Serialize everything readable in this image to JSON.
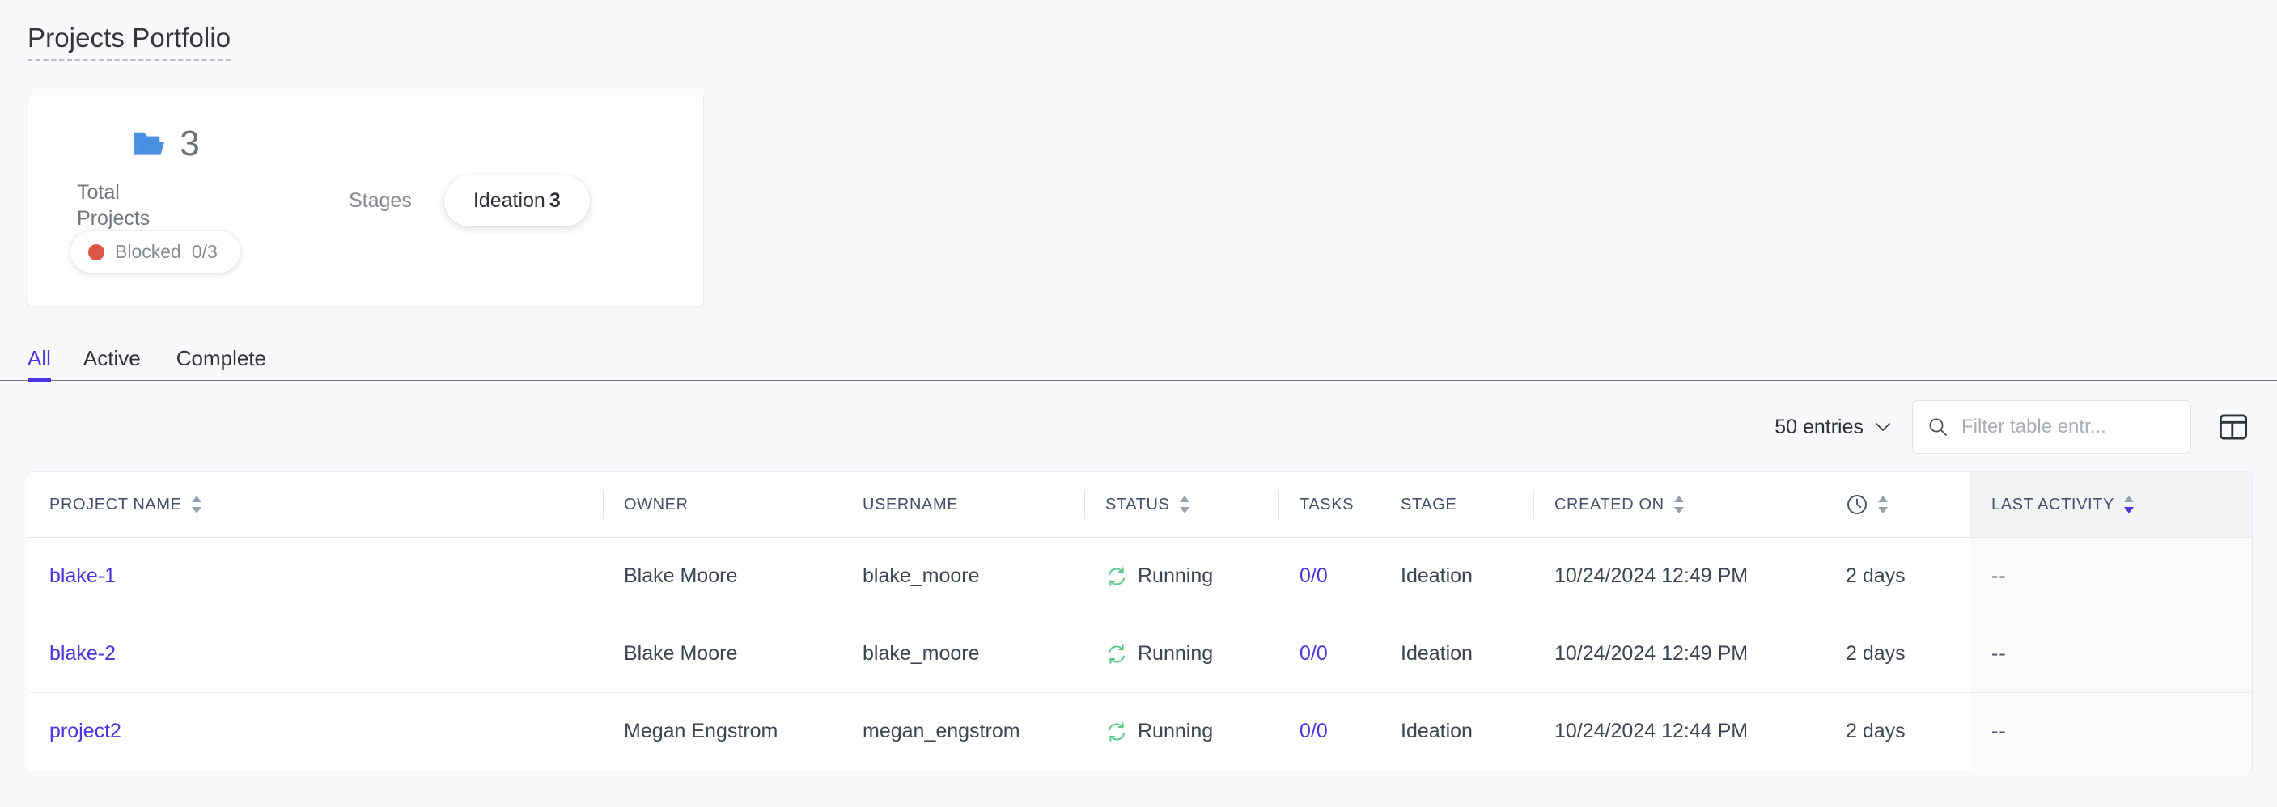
{
  "page": {
    "title": "Projects Portfolio"
  },
  "summary": {
    "total_card": {
      "icon": "folder-icon",
      "count": "3",
      "label": "Total Projects",
      "blocked_badge": {
        "dot_color": "#dc5549",
        "label": "Blocked",
        "value": "0/3"
      }
    },
    "stages_card": {
      "label": "Stages",
      "pills": [
        {
          "name": "Ideation",
          "count": "3"
        }
      ]
    }
  },
  "tabs": [
    {
      "label": "All",
      "active": true
    },
    {
      "label": "Active",
      "active": false
    },
    {
      "label": "Complete",
      "active": false
    }
  ],
  "toolbar": {
    "entries_label": "50 entries",
    "search_placeholder": "Filter table entr...",
    "search_value": "",
    "layout_button_title": "Table layout"
  },
  "table": {
    "columns": [
      {
        "key": "project_name",
        "label": "PROJECT NAME",
        "sortable": true,
        "sorted": "none"
      },
      {
        "key": "owner",
        "label": "OWNER",
        "sortable": false,
        "sorted": "none"
      },
      {
        "key": "username",
        "label": "USERNAME",
        "sortable": false,
        "sorted": "none"
      },
      {
        "key": "status",
        "label": "STATUS",
        "sortable": true,
        "sorted": "none"
      },
      {
        "key": "tasks",
        "label": "TASKS",
        "sortable": false,
        "sorted": "none"
      },
      {
        "key": "stage",
        "label": "STAGE",
        "sortable": false,
        "sorted": "none"
      },
      {
        "key": "created_on",
        "label": "CREATED ON",
        "sortable": true,
        "sorted": "none"
      },
      {
        "key": "duration",
        "label": "",
        "sortable": true,
        "sorted": "none",
        "icon": "clock-icon"
      },
      {
        "key": "last_activity",
        "label": "LAST ACTIVITY",
        "sortable": true,
        "sorted": "desc"
      }
    ],
    "rows": [
      {
        "project_name": "blake-1",
        "owner": "Blake Moore",
        "username": "blake_moore",
        "status": "Running",
        "status_icon": "sync-icon",
        "tasks": "0/0",
        "stage": "Ideation",
        "created_on": "10/24/2024 12:49 PM",
        "duration": "2 days",
        "last_activity": "--"
      },
      {
        "project_name": "blake-2",
        "owner": "Blake Moore",
        "username": "blake_moore",
        "status": "Running",
        "status_icon": "sync-icon",
        "tasks": "0/0",
        "stage": "Ideation",
        "created_on": "10/24/2024 12:49 PM",
        "duration": "2 days",
        "last_activity": "--"
      },
      {
        "project_name": "project2",
        "owner": "Megan Engstrom",
        "username": "megan_engstrom",
        "status": "Running",
        "status_icon": "sync-icon",
        "tasks": "0/0",
        "stage": "Ideation",
        "created_on": "10/24/2024 12:44 PM",
        "duration": "2 days",
        "last_activity": "--"
      }
    ]
  },
  "colors": {
    "accent": "#4b35e0",
    "page_bg": "#f7f9fb",
    "status_running": "#5cc98a",
    "blocked": "#dc5549",
    "folder": "#4a90e2",
    "header_text": "#464f6b"
  }
}
